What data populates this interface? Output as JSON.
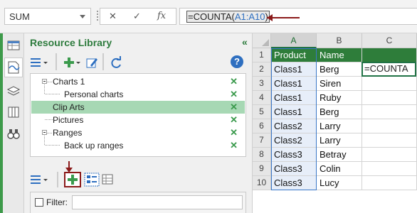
{
  "formula_bar": {
    "name_box": "SUM",
    "cancel_icon": "✕",
    "enter_icon": "✓",
    "fx_label": "fx",
    "formula_prefix": "=COUNTA(",
    "formula_ref": "A1:A10",
    "formula_suffix": ")",
    "arrow_color": "#8b1a1a"
  },
  "panel": {
    "title": "Resource Library",
    "collapse_icon": "«",
    "help_icon": "?",
    "tree": [
      {
        "label": "Charts 1",
        "level": 0,
        "expanded": true,
        "selected": false
      },
      {
        "label": "Personal charts",
        "level": 1,
        "selected": false
      },
      {
        "label": "Clip Arts",
        "level": 0,
        "selected": true
      },
      {
        "label": "Pictures",
        "level": 0,
        "selected": false
      },
      {
        "label": "Ranges",
        "level": 0,
        "expanded": true,
        "selected": false
      },
      {
        "label": "Back up ranges",
        "level": 1,
        "selected": false
      }
    ],
    "filter_label": "Filter:",
    "filter_value": ""
  },
  "sheet": {
    "columns": [
      "A",
      "B",
      "C"
    ],
    "rows": [
      "1",
      "2",
      "3",
      "4",
      "5",
      "6",
      "7",
      "8",
      "9",
      "10"
    ],
    "cells": [
      [
        "Product",
        "Name",
        ""
      ],
      [
        "Class1",
        "Berg",
        "=COUNTA"
      ],
      [
        "Class1",
        "Siren",
        ""
      ],
      [
        "Class1",
        "Ruby",
        ""
      ],
      [
        "Class1",
        "Berg",
        ""
      ],
      [
        "Class2",
        "Larry",
        ""
      ],
      [
        "Class2",
        "Larry",
        ""
      ],
      [
        "Class3",
        "Betray",
        ""
      ],
      [
        "Class3",
        "Colin",
        ""
      ],
      [
        "Class3",
        "Lucy",
        ""
      ]
    ],
    "header_fill": "#2e7d3a",
    "accent": "#217346"
  }
}
